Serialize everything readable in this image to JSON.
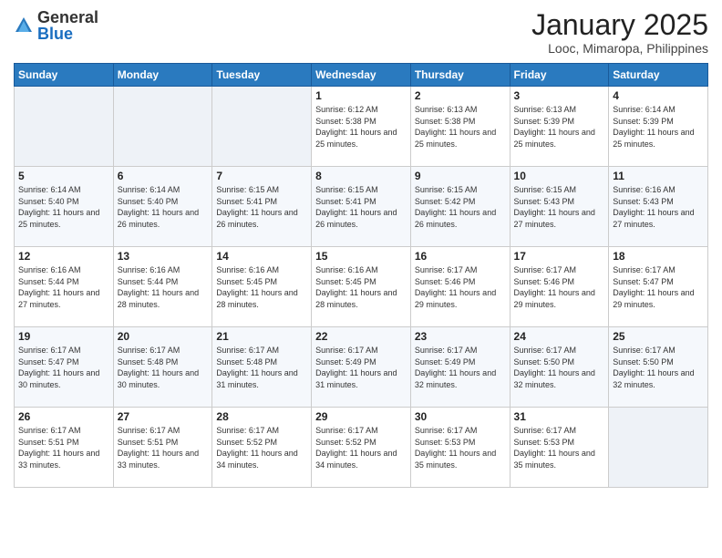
{
  "logo": {
    "general": "General",
    "blue": "Blue"
  },
  "header": {
    "month": "January 2025",
    "location": "Looc, Mimaropa, Philippines"
  },
  "days_of_week": [
    "Sunday",
    "Monday",
    "Tuesday",
    "Wednesday",
    "Thursday",
    "Friday",
    "Saturday"
  ],
  "weeks": [
    [
      {
        "day": "",
        "sunrise": "",
        "sunset": "",
        "daylight": ""
      },
      {
        "day": "",
        "sunrise": "",
        "sunset": "",
        "daylight": ""
      },
      {
        "day": "",
        "sunrise": "",
        "sunset": "",
        "daylight": ""
      },
      {
        "day": "1",
        "sunrise": "Sunrise: 6:12 AM",
        "sunset": "Sunset: 5:38 PM",
        "daylight": "Daylight: 11 hours and 25 minutes."
      },
      {
        "day": "2",
        "sunrise": "Sunrise: 6:13 AM",
        "sunset": "Sunset: 5:38 PM",
        "daylight": "Daylight: 11 hours and 25 minutes."
      },
      {
        "day": "3",
        "sunrise": "Sunrise: 6:13 AM",
        "sunset": "Sunset: 5:39 PM",
        "daylight": "Daylight: 11 hours and 25 minutes."
      },
      {
        "day": "4",
        "sunrise": "Sunrise: 6:14 AM",
        "sunset": "Sunset: 5:39 PM",
        "daylight": "Daylight: 11 hours and 25 minutes."
      }
    ],
    [
      {
        "day": "5",
        "sunrise": "Sunrise: 6:14 AM",
        "sunset": "Sunset: 5:40 PM",
        "daylight": "Daylight: 11 hours and 25 minutes."
      },
      {
        "day": "6",
        "sunrise": "Sunrise: 6:14 AM",
        "sunset": "Sunset: 5:40 PM",
        "daylight": "Daylight: 11 hours and 26 minutes."
      },
      {
        "day": "7",
        "sunrise": "Sunrise: 6:15 AM",
        "sunset": "Sunset: 5:41 PM",
        "daylight": "Daylight: 11 hours and 26 minutes."
      },
      {
        "day": "8",
        "sunrise": "Sunrise: 6:15 AM",
        "sunset": "Sunset: 5:41 PM",
        "daylight": "Daylight: 11 hours and 26 minutes."
      },
      {
        "day": "9",
        "sunrise": "Sunrise: 6:15 AM",
        "sunset": "Sunset: 5:42 PM",
        "daylight": "Daylight: 11 hours and 26 minutes."
      },
      {
        "day": "10",
        "sunrise": "Sunrise: 6:15 AM",
        "sunset": "Sunset: 5:43 PM",
        "daylight": "Daylight: 11 hours and 27 minutes."
      },
      {
        "day": "11",
        "sunrise": "Sunrise: 6:16 AM",
        "sunset": "Sunset: 5:43 PM",
        "daylight": "Daylight: 11 hours and 27 minutes."
      }
    ],
    [
      {
        "day": "12",
        "sunrise": "Sunrise: 6:16 AM",
        "sunset": "Sunset: 5:44 PM",
        "daylight": "Daylight: 11 hours and 27 minutes."
      },
      {
        "day": "13",
        "sunrise": "Sunrise: 6:16 AM",
        "sunset": "Sunset: 5:44 PM",
        "daylight": "Daylight: 11 hours and 28 minutes."
      },
      {
        "day": "14",
        "sunrise": "Sunrise: 6:16 AM",
        "sunset": "Sunset: 5:45 PM",
        "daylight": "Daylight: 11 hours and 28 minutes."
      },
      {
        "day": "15",
        "sunrise": "Sunrise: 6:16 AM",
        "sunset": "Sunset: 5:45 PM",
        "daylight": "Daylight: 11 hours and 28 minutes."
      },
      {
        "day": "16",
        "sunrise": "Sunrise: 6:17 AM",
        "sunset": "Sunset: 5:46 PM",
        "daylight": "Daylight: 11 hours and 29 minutes."
      },
      {
        "day": "17",
        "sunrise": "Sunrise: 6:17 AM",
        "sunset": "Sunset: 5:46 PM",
        "daylight": "Daylight: 11 hours and 29 minutes."
      },
      {
        "day": "18",
        "sunrise": "Sunrise: 6:17 AM",
        "sunset": "Sunset: 5:47 PM",
        "daylight": "Daylight: 11 hours and 29 minutes."
      }
    ],
    [
      {
        "day": "19",
        "sunrise": "Sunrise: 6:17 AM",
        "sunset": "Sunset: 5:47 PM",
        "daylight": "Daylight: 11 hours and 30 minutes."
      },
      {
        "day": "20",
        "sunrise": "Sunrise: 6:17 AM",
        "sunset": "Sunset: 5:48 PM",
        "daylight": "Daylight: 11 hours and 30 minutes."
      },
      {
        "day": "21",
        "sunrise": "Sunrise: 6:17 AM",
        "sunset": "Sunset: 5:48 PM",
        "daylight": "Daylight: 11 hours and 31 minutes."
      },
      {
        "day": "22",
        "sunrise": "Sunrise: 6:17 AM",
        "sunset": "Sunset: 5:49 PM",
        "daylight": "Daylight: 11 hours and 31 minutes."
      },
      {
        "day": "23",
        "sunrise": "Sunrise: 6:17 AM",
        "sunset": "Sunset: 5:49 PM",
        "daylight": "Daylight: 11 hours and 32 minutes."
      },
      {
        "day": "24",
        "sunrise": "Sunrise: 6:17 AM",
        "sunset": "Sunset: 5:50 PM",
        "daylight": "Daylight: 11 hours and 32 minutes."
      },
      {
        "day": "25",
        "sunrise": "Sunrise: 6:17 AM",
        "sunset": "Sunset: 5:50 PM",
        "daylight": "Daylight: 11 hours and 32 minutes."
      }
    ],
    [
      {
        "day": "26",
        "sunrise": "Sunrise: 6:17 AM",
        "sunset": "Sunset: 5:51 PM",
        "daylight": "Daylight: 11 hours and 33 minutes."
      },
      {
        "day": "27",
        "sunrise": "Sunrise: 6:17 AM",
        "sunset": "Sunset: 5:51 PM",
        "daylight": "Daylight: 11 hours and 33 minutes."
      },
      {
        "day": "28",
        "sunrise": "Sunrise: 6:17 AM",
        "sunset": "Sunset: 5:52 PM",
        "daylight": "Daylight: 11 hours and 34 minutes."
      },
      {
        "day": "29",
        "sunrise": "Sunrise: 6:17 AM",
        "sunset": "Sunset: 5:52 PM",
        "daylight": "Daylight: 11 hours and 34 minutes."
      },
      {
        "day": "30",
        "sunrise": "Sunrise: 6:17 AM",
        "sunset": "Sunset: 5:53 PM",
        "daylight": "Daylight: 11 hours and 35 minutes."
      },
      {
        "day": "31",
        "sunrise": "Sunrise: 6:17 AM",
        "sunset": "Sunset: 5:53 PM",
        "daylight": "Daylight: 11 hours and 35 minutes."
      },
      {
        "day": "",
        "sunrise": "",
        "sunset": "",
        "daylight": ""
      }
    ]
  ]
}
